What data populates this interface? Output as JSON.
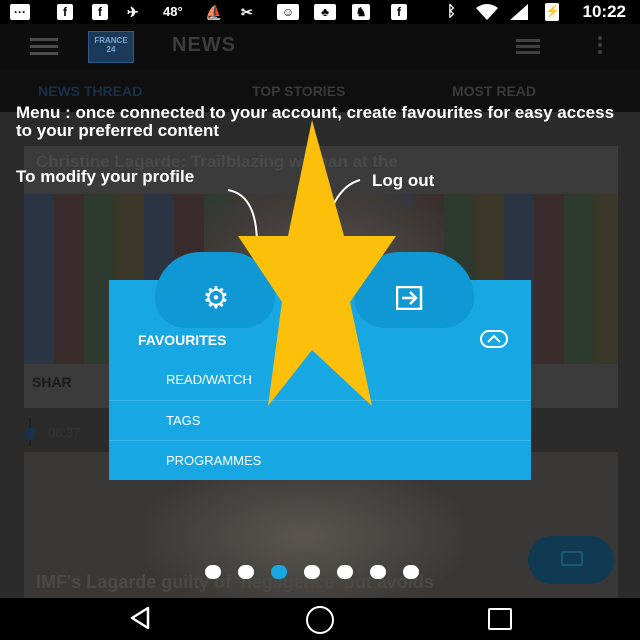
{
  "status_bar": {
    "temperature": "48°",
    "clock": "10:22",
    "icons": [
      "message-icon",
      "facebook-icon",
      "facebook-icon",
      "airplane-icon",
      "temperature",
      "kayak-icon",
      "tools-icon",
      "mask-icon",
      "game-icon",
      "fox-icon",
      "facebook-icon",
      "bluetooth-icon",
      "wifi-icon",
      "signal-icon",
      "battery-icon"
    ]
  },
  "app_bar": {
    "logo_text": "FRANCE 24",
    "title": "NEWS"
  },
  "tabs": [
    {
      "label": "NEWS THREAD",
      "active": true
    },
    {
      "label": "TOP STORIES",
      "active": false
    },
    {
      "label": "MOST READ",
      "active": false
    }
  ],
  "feed": {
    "card1_title": "Christine Lagarde: Trailblazing woman at the",
    "share_label": "SHAR",
    "time": "08:37",
    "card2_title": "IMF's Lagarde guilty of 'negligence' but avoids"
  },
  "tutorial": {
    "menu_tip": "Menu : once connected to your account, create favourites for easy access to your preferred content",
    "profile_tip": "To modify your profile",
    "logout_tip": "Log out"
  },
  "menu": {
    "favourites_label": "FAVOURITES",
    "items": [
      "READ/WATCH",
      "TAGS",
      "PROGRAMMES"
    ]
  },
  "pager": {
    "count": 7,
    "active_index": 2
  },
  "colors": {
    "menu_blue": "#17a8e4",
    "menu_blue_dark": "#0f98d3",
    "star_yellow": "#fcbf0a",
    "active_dot": "#19a7e2"
  }
}
